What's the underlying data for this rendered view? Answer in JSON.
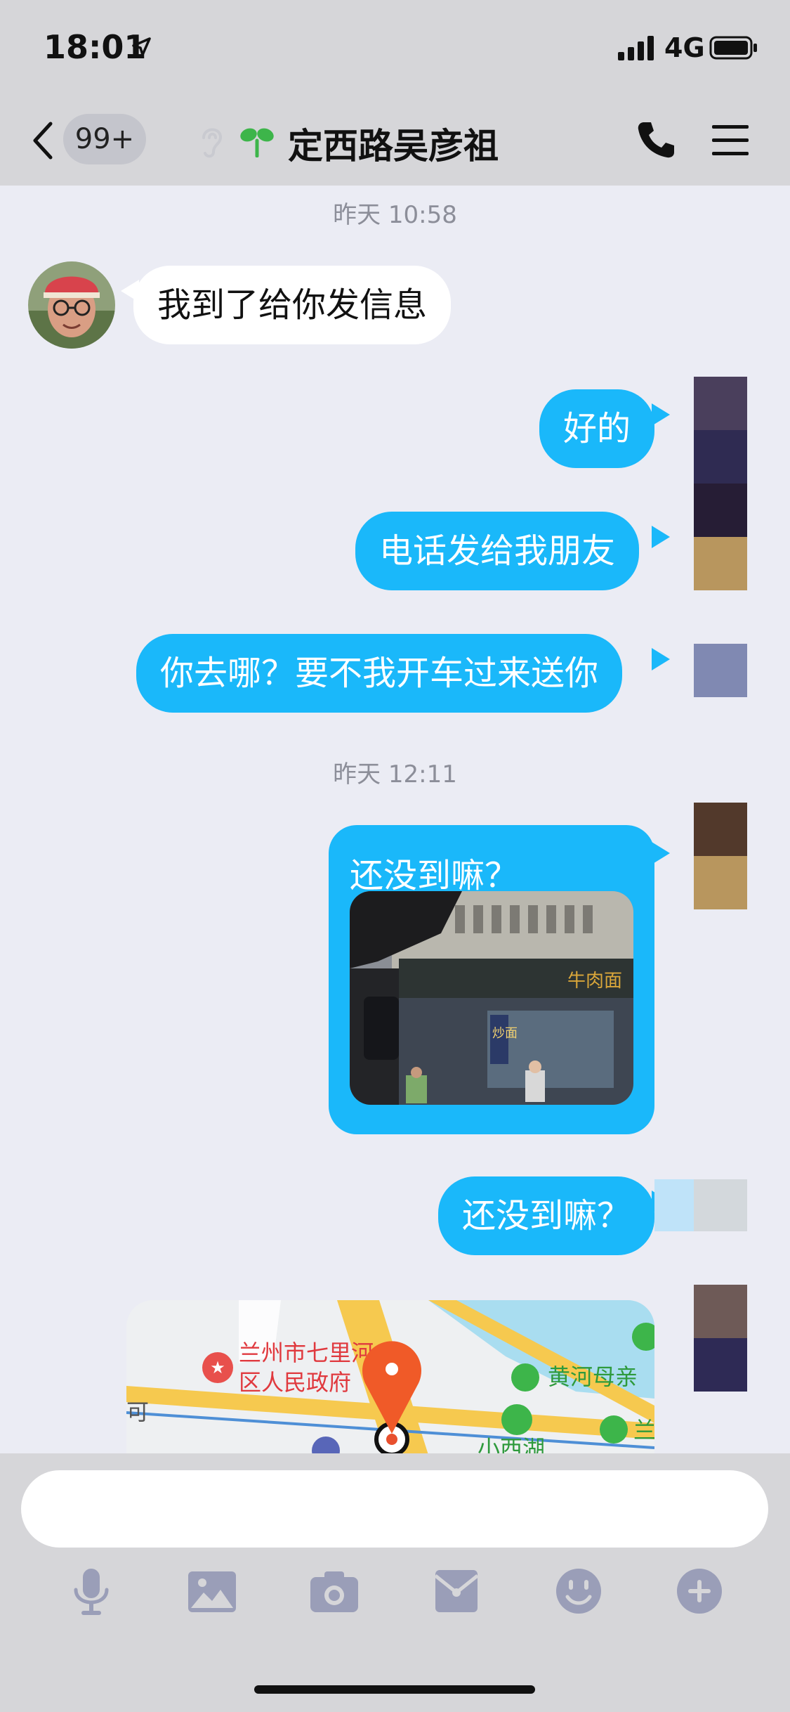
{
  "status_bar": {
    "time": "18:01",
    "network": "4G"
  },
  "nav": {
    "back_badge": "99+",
    "title": "定西路吴彦祖"
  },
  "timestamps": [
    "昨天 10:58",
    "昨天 12:11"
  ],
  "messages": [
    {
      "side": "incoming",
      "text": "我到了给你发信息"
    },
    {
      "side": "outgoing",
      "text": "好的"
    },
    {
      "side": "outgoing",
      "text": "电话发给我朋友"
    },
    {
      "side": "outgoing",
      "text": "你去哪？要不我开车过来送你"
    },
    {
      "side": "outgoing",
      "text": "还没到嘛？",
      "has_image": true
    },
    {
      "side": "outgoing",
      "text": "还没到嘛？"
    }
  ],
  "map": {
    "labels": [
      "兰州市七里河",
      "区人民政府",
      "黄河母亲",
      "小西湖",
      "可",
      "兰"
    ]
  },
  "photo": {
    "sign_text": "牛肉面",
    "side_sign": "炒面"
  },
  "toolbar": [
    "microphone-icon",
    "image-icon",
    "camera-icon",
    "envelope-icon",
    "emoji-icon",
    "plus-icon"
  ],
  "colors": {
    "outgoing_bubble": "#1AB8FA",
    "incoming_bubble": "#FFFFFF",
    "chat_bg": "#EBECF4",
    "bar_bg": "#D6D6D9",
    "icon": "#9A9EB8"
  }
}
